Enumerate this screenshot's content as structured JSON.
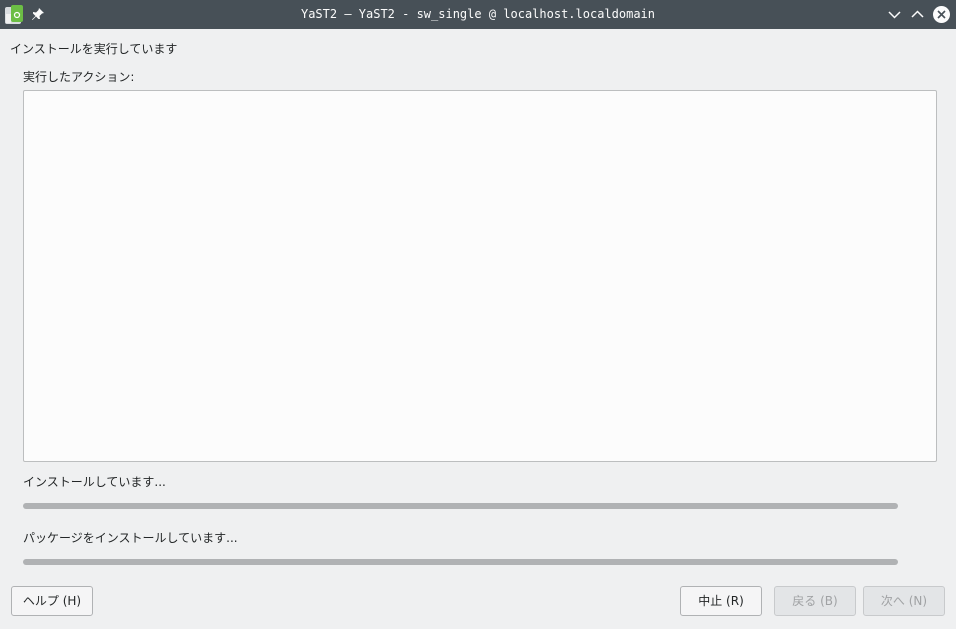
{
  "window": {
    "title": "YaST2 — YaST2 - sw_single @ localhost.localdomain",
    "app_icon": "yast-app-icon",
    "pin_icon": "pin-icon",
    "controls": [
      "chevron-down-icon",
      "chevron-up-icon",
      "close-icon"
    ]
  },
  "main": {
    "heading": "インストールを実行しています",
    "actions_label": "実行したアクション:",
    "actions_log": "",
    "overall_progress": {
      "label": "インストールしています...",
      "value": 0
    },
    "package_progress": {
      "label": "パッケージをインストールしています...",
      "value": 0
    }
  },
  "buttons": {
    "help": "ヘルプ (H)",
    "abort": "中止 (R)",
    "back": "戻る (B)",
    "next": "次へ (N)"
  },
  "colors": {
    "titlebar": "#475057",
    "window_bg": "#eff0f1",
    "accent": "#3daee9"
  }
}
